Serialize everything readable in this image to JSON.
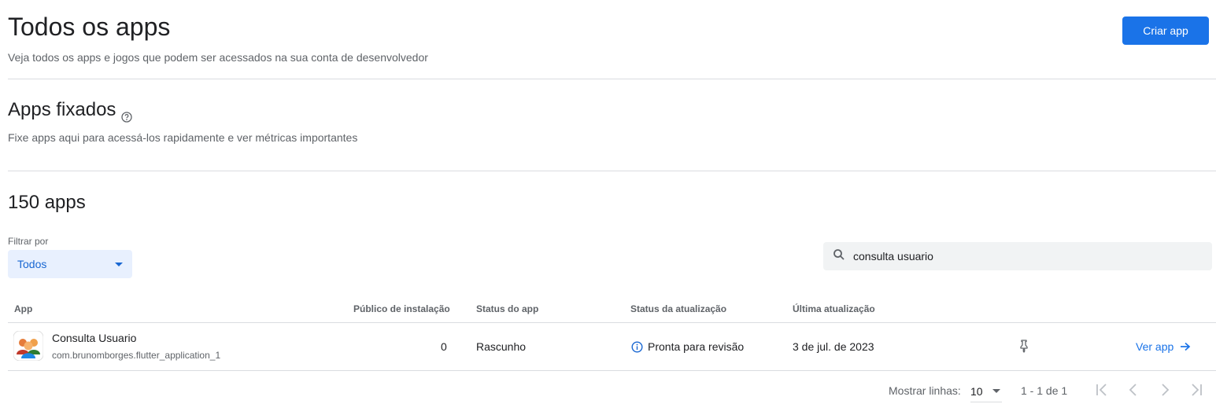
{
  "header": {
    "title": "Todos os apps",
    "subtitle": "Veja todos os apps e jogos que podem ser acessados na sua conta de desenvolvedor",
    "create_button": "Criar app"
  },
  "pinned": {
    "title": "Apps fixados",
    "help_icon": "help-circle-icon",
    "subtitle": "Fixe apps aqui para acessá-los rapidamente e ver métricas importantes"
  },
  "apps": {
    "count_label": "150 apps",
    "filter": {
      "label": "Filtrar por",
      "selected": "Todos"
    },
    "search": {
      "icon": "search-icon",
      "value": "consulta usuario"
    },
    "columns": {
      "app": "App",
      "audience": "Público de instalação",
      "app_status": "Status do app",
      "update_status": "Status da atualização",
      "last_update": "Última atualização"
    },
    "rows": [
      {
        "name": "Consulta Usuario",
        "package": "com.brunomborges.flutter_application_1",
        "installs": "0",
        "app_status": "Rascunho",
        "update_status": "Pronta para revisão",
        "last_update": "3 de jul. de 2023",
        "action": "Ver app"
      }
    ]
  },
  "pagination": {
    "rows_label": "Mostrar linhas:",
    "rows_value": "10",
    "range": "1 - 1 de 1"
  },
  "colors": {
    "accent": "#1a73e8",
    "filter_bg": "#e8f0fe",
    "text_primary": "#202124",
    "text_secondary": "#5f6368",
    "divider": "#dadce0"
  }
}
